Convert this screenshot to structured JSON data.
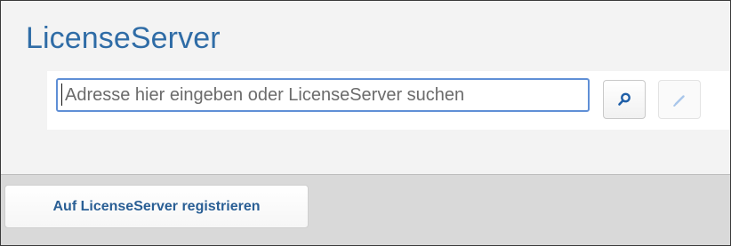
{
  "app": {
    "title": "LicenseServer"
  },
  "search": {
    "placeholder": "Adresse hier eingeben oder LicenseServer suchen",
    "value": "",
    "search_icon": "search-icon",
    "edit_icon": "edit-icon"
  },
  "actions": {
    "register_label": "Auf LicenseServer registrieren"
  },
  "colors": {
    "title": "#2f6ca6",
    "input_border": "#5f8fd6",
    "button_text": "#2a5f95",
    "bottom_bar": "#d9d9d9"
  }
}
